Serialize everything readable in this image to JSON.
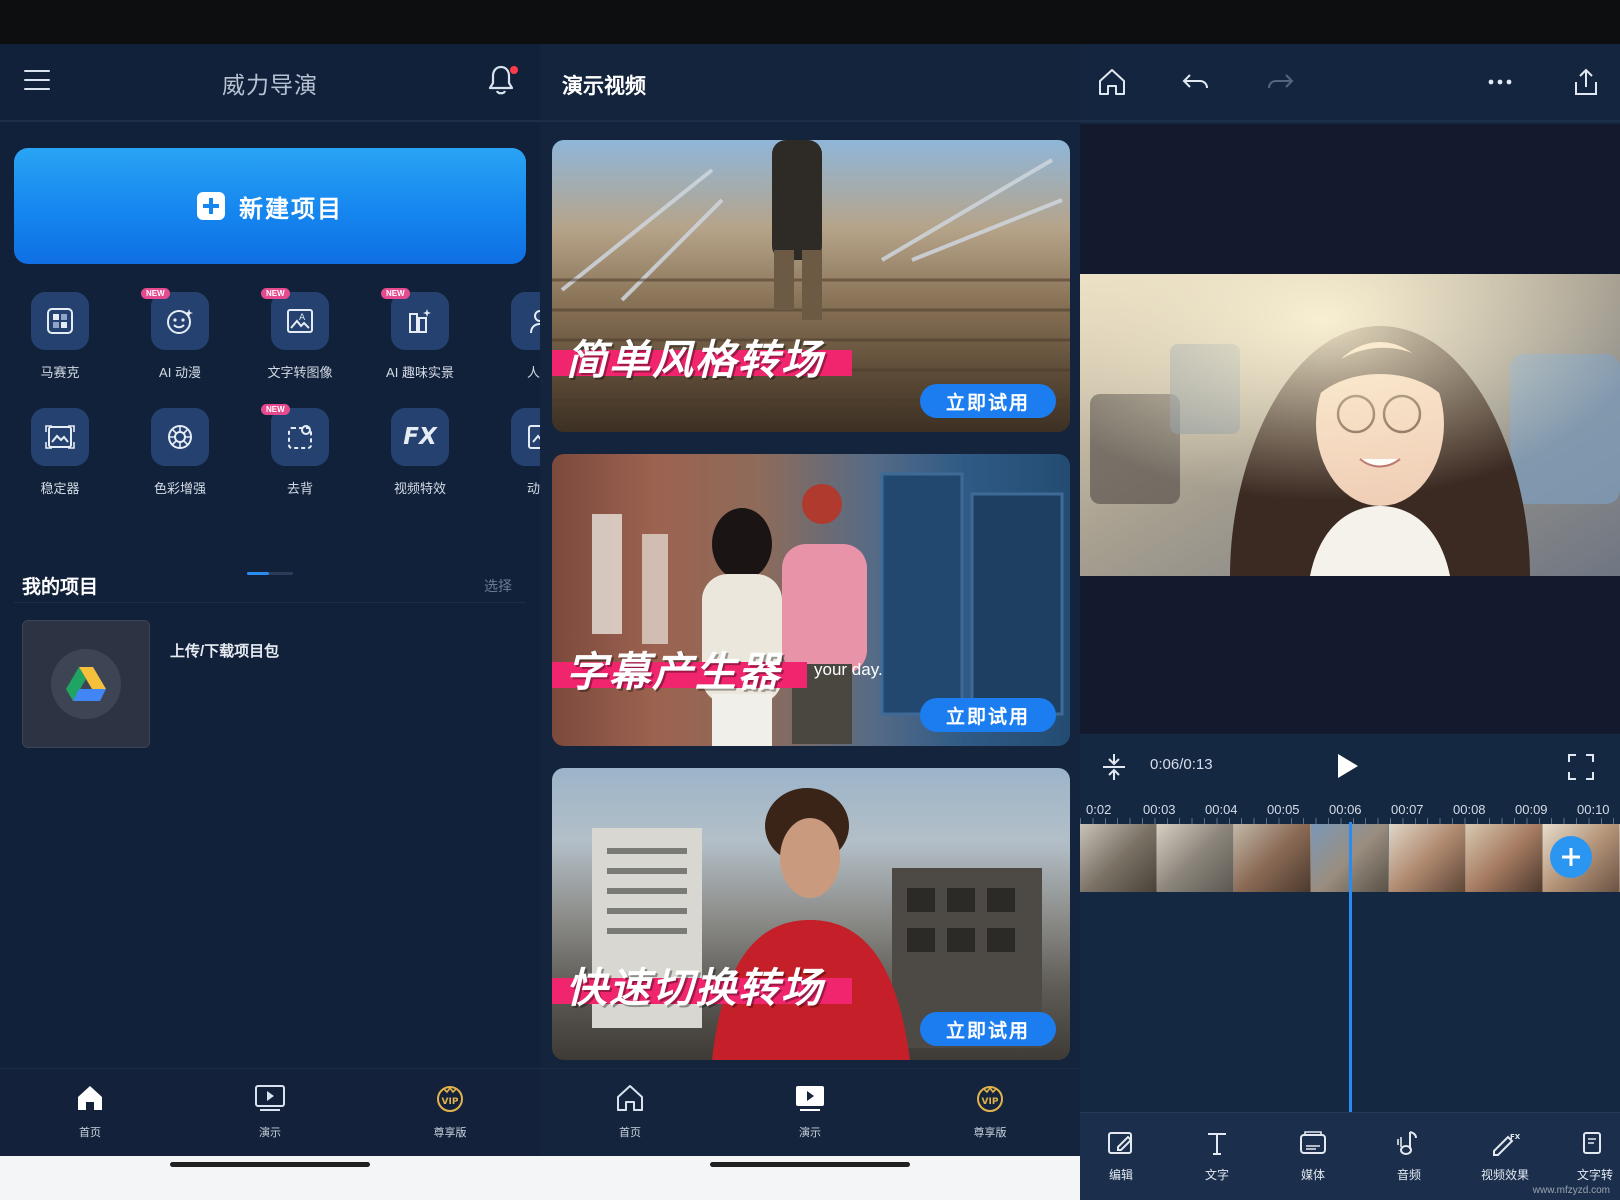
{
  "home": {
    "app_title": "威力导演",
    "new_project_label": "新建项目",
    "tools": [
      {
        "label": "马赛克",
        "icon": "mosaic-icon",
        "is_new": false
      },
      {
        "label": "AI 动漫",
        "icon": "ai-anime-icon",
        "is_new": true
      },
      {
        "label": "文字转图像",
        "icon": "text-to-image-icon",
        "is_new": true
      },
      {
        "label": "AI 趣味实景",
        "icon": "ai-scene-icon",
        "is_new": true
      },
      {
        "label": "人物",
        "icon": "person-icon",
        "is_new": false
      },
      {
        "label": "稳定器",
        "icon": "stabilizer-icon",
        "is_new": false
      },
      {
        "label": "色彩增强",
        "icon": "color-enhance-icon",
        "is_new": false
      },
      {
        "label": "去背",
        "icon": "remove-background-icon",
        "is_new": true
      },
      {
        "label": "视频特效",
        "icon": "fx-icon",
        "is_new": false
      },
      {
        "label": "动漫",
        "icon": "anime-icon",
        "is_new": false
      }
    ],
    "new_badge": "NEW",
    "fx_glyph": "FX",
    "my_projects_title": "我的项目",
    "select_label": "选择",
    "project_card_label": "上传/下载项目包"
  },
  "nav": {
    "items": [
      {
        "label": "首页",
        "icon": "home-icon"
      },
      {
        "label": "演示",
        "icon": "demo-play-icon"
      },
      {
        "label": "尊享版",
        "icon": "vip-crown-icon"
      }
    ],
    "vip_glyph": "VIP"
  },
  "demo": {
    "title": "演示视频",
    "cards": [
      {
        "caption": "简单风格转场",
        "button": "立即试用"
      },
      {
        "caption": "字幕产生器",
        "button": "立即试用",
        "overlay_text": "your day."
      },
      {
        "caption": "快速切换转场",
        "button": "立即试用"
      }
    ]
  },
  "editor": {
    "timecode": "0:06/0:13",
    "ruler_labels": [
      "0:02",
      "00:03",
      "00:04",
      "00:05",
      "00:06",
      "00:07",
      "00:08",
      "00:09",
      "00:10"
    ],
    "toolbar": [
      {
        "label": "编辑",
        "icon": "edit-icon"
      },
      {
        "label": "文字",
        "icon": "text-icon"
      },
      {
        "label": "媒体",
        "icon": "media-icon"
      },
      {
        "label": "音频",
        "icon": "audio-icon"
      },
      {
        "label": "视频效果",
        "icon": "video-effects-icon"
      },
      {
        "label": "文字转",
        "icon": "text-convert-icon"
      }
    ],
    "watermark": "www.mfzyzd.com"
  },
  "colors": {
    "accent": "#1b7df0",
    "caption_highlight": "#f0256e",
    "background": "#12213a"
  }
}
